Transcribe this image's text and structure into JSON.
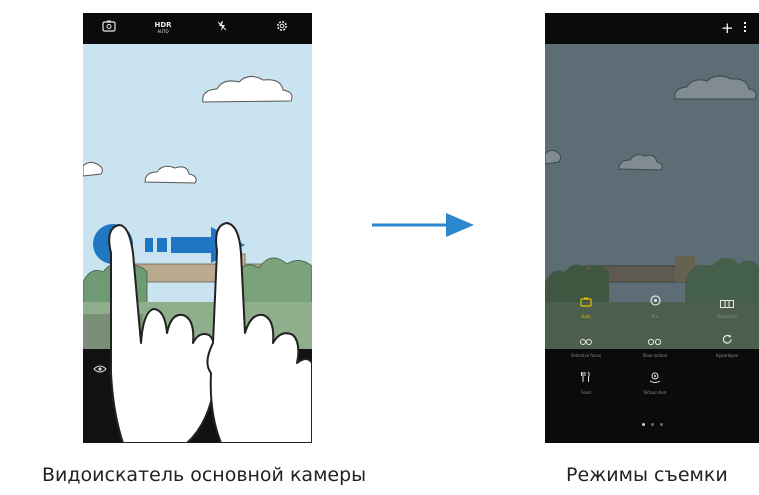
{
  "colors": {
    "accent_blue": "#1f76c2",
    "arrow_blue": "#2b88cf",
    "sky": "#c9e3f0",
    "mode_selected": "#e6c200"
  },
  "viewfinder": {
    "top_icons": [
      "switch-camera-icon",
      "hdr-auto-icon",
      "flash-off-icon",
      "settings-icon"
    ],
    "hdr_label": "HDR",
    "hdr_sublabel": "AUTO",
    "bottom_icons": [
      "eye-icon"
    ]
  },
  "modes_screen": {
    "top_icons": [
      "add-icon",
      "more-options-icon"
    ],
    "modes": [
      {
        "icon": "auto-mode-icon",
        "label": "Auto"
      },
      {
        "icon": "pro-mode-icon",
        "label": "Pro"
      },
      {
        "icon": "panorama-mode-icon",
        "label": "Panorama"
      },
      {
        "icon": "selective-focus-icon",
        "label": "Selective focus"
      },
      {
        "icon": "slow-motion-icon",
        "label": "Slow motion"
      },
      {
        "icon": "hyperlapse-icon",
        "label": "Hyperlapse"
      },
      {
        "icon": "food-mode-icon",
        "label": "Food"
      },
      {
        "icon": "virtual-shot-icon",
        "label": "Virtual shot"
      }
    ],
    "page_dots": 3
  },
  "captions": {
    "left": "Видоискатель основной камеры",
    "right": "Режимы съемки"
  }
}
